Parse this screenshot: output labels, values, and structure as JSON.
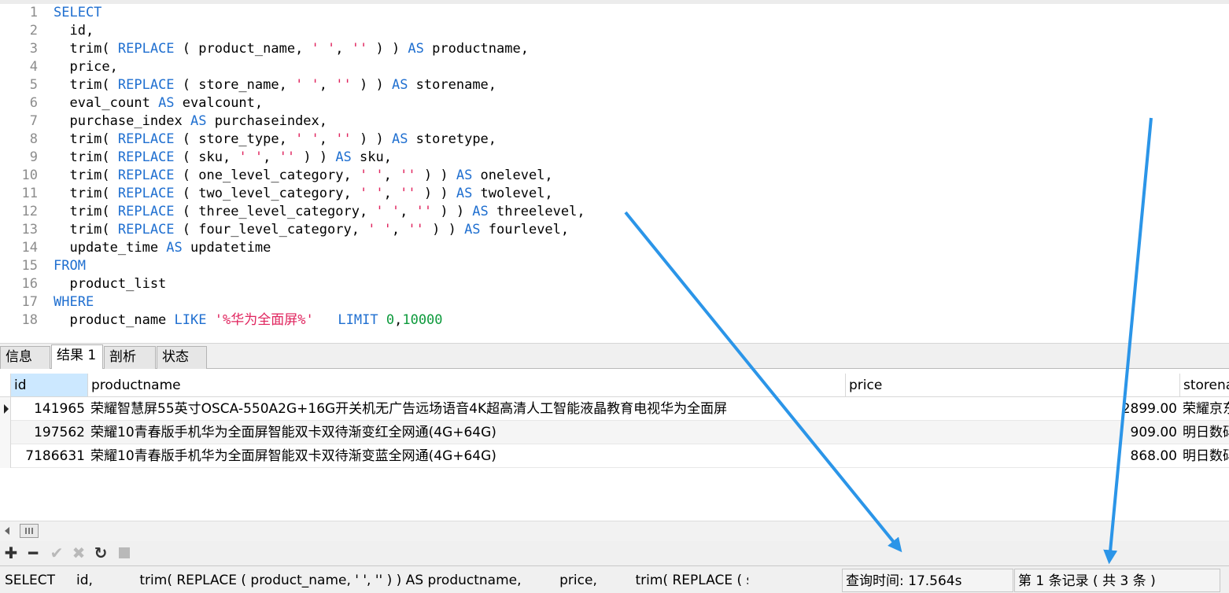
{
  "editor": {
    "lines": [
      {
        "n": "1",
        "tokens": [
          {
            "t": "SELECT",
            "c": "kw"
          }
        ]
      },
      {
        "n": "2",
        "tokens": [
          {
            "t": "  id,",
            "c": "plain"
          }
        ]
      },
      {
        "n": "3",
        "tokens": [
          {
            "t": "  trim( ",
            "c": "plain"
          },
          {
            "t": "REPLACE",
            "c": "kw"
          },
          {
            "t": " ( product_name, ",
            "c": "plain"
          },
          {
            "t": "' '",
            "c": "str"
          },
          {
            "t": ", ",
            "c": "plain"
          },
          {
            "t": "''",
            "c": "str"
          },
          {
            "t": " ) ) ",
            "c": "plain"
          },
          {
            "t": "AS",
            "c": "kw"
          },
          {
            "t": " productname,",
            "c": "plain"
          }
        ]
      },
      {
        "n": "4",
        "tokens": [
          {
            "t": "  price,",
            "c": "plain"
          }
        ]
      },
      {
        "n": "5",
        "tokens": [
          {
            "t": "  trim( ",
            "c": "plain"
          },
          {
            "t": "REPLACE",
            "c": "kw"
          },
          {
            "t": " ( store_name, ",
            "c": "plain"
          },
          {
            "t": "' '",
            "c": "str"
          },
          {
            "t": ", ",
            "c": "plain"
          },
          {
            "t": "''",
            "c": "str"
          },
          {
            "t": " ) ) ",
            "c": "plain"
          },
          {
            "t": "AS",
            "c": "kw"
          },
          {
            "t": " storename,",
            "c": "plain"
          }
        ]
      },
      {
        "n": "6",
        "tokens": [
          {
            "t": "  eval_count ",
            "c": "plain"
          },
          {
            "t": "AS",
            "c": "kw"
          },
          {
            "t": " evalcount,",
            "c": "plain"
          }
        ]
      },
      {
        "n": "7",
        "tokens": [
          {
            "t": "  purchase_index ",
            "c": "plain"
          },
          {
            "t": "AS",
            "c": "kw"
          },
          {
            "t": " purchaseindex,",
            "c": "plain"
          }
        ]
      },
      {
        "n": "8",
        "tokens": [
          {
            "t": "  trim( ",
            "c": "plain"
          },
          {
            "t": "REPLACE",
            "c": "kw"
          },
          {
            "t": " ( store_type, ",
            "c": "plain"
          },
          {
            "t": "' '",
            "c": "str"
          },
          {
            "t": ", ",
            "c": "plain"
          },
          {
            "t": "''",
            "c": "str"
          },
          {
            "t": " ) ) ",
            "c": "plain"
          },
          {
            "t": "AS",
            "c": "kw"
          },
          {
            "t": " storetype,",
            "c": "plain"
          }
        ]
      },
      {
        "n": "9",
        "tokens": [
          {
            "t": "  trim( ",
            "c": "plain"
          },
          {
            "t": "REPLACE",
            "c": "kw"
          },
          {
            "t": " ( sku, ",
            "c": "plain"
          },
          {
            "t": "' '",
            "c": "str"
          },
          {
            "t": ", ",
            "c": "plain"
          },
          {
            "t": "''",
            "c": "str"
          },
          {
            "t": " ) ) ",
            "c": "plain"
          },
          {
            "t": "AS",
            "c": "kw"
          },
          {
            "t": " sku,",
            "c": "plain"
          }
        ]
      },
      {
        "n": "10",
        "tokens": [
          {
            "t": "  trim( ",
            "c": "plain"
          },
          {
            "t": "REPLACE",
            "c": "kw"
          },
          {
            "t": " ( one_level_category, ",
            "c": "plain"
          },
          {
            "t": "' '",
            "c": "str"
          },
          {
            "t": ", ",
            "c": "plain"
          },
          {
            "t": "''",
            "c": "str"
          },
          {
            "t": " ) ) ",
            "c": "plain"
          },
          {
            "t": "AS",
            "c": "kw"
          },
          {
            "t": " onelevel,",
            "c": "plain"
          }
        ]
      },
      {
        "n": "11",
        "tokens": [
          {
            "t": "  trim( ",
            "c": "plain"
          },
          {
            "t": "REPLACE",
            "c": "kw"
          },
          {
            "t": " ( two_level_category, ",
            "c": "plain"
          },
          {
            "t": "' '",
            "c": "str"
          },
          {
            "t": ", ",
            "c": "plain"
          },
          {
            "t": "''",
            "c": "str"
          },
          {
            "t": " ) ) ",
            "c": "plain"
          },
          {
            "t": "AS",
            "c": "kw"
          },
          {
            "t": " twolevel,",
            "c": "plain"
          }
        ]
      },
      {
        "n": "12",
        "tokens": [
          {
            "t": "  trim( ",
            "c": "plain"
          },
          {
            "t": "REPLACE",
            "c": "kw"
          },
          {
            "t": " ( three_level_category, ",
            "c": "plain"
          },
          {
            "t": "' '",
            "c": "str"
          },
          {
            "t": ", ",
            "c": "plain"
          },
          {
            "t": "''",
            "c": "str"
          },
          {
            "t": " ) ) ",
            "c": "plain"
          },
          {
            "t": "AS",
            "c": "kw"
          },
          {
            "t": " threelevel,",
            "c": "plain"
          }
        ]
      },
      {
        "n": "13",
        "tokens": [
          {
            "t": "  trim( ",
            "c": "plain"
          },
          {
            "t": "REPLACE",
            "c": "kw"
          },
          {
            "t": " ( four_level_category, ",
            "c": "plain"
          },
          {
            "t": "' '",
            "c": "str"
          },
          {
            "t": ", ",
            "c": "plain"
          },
          {
            "t": "''",
            "c": "str"
          },
          {
            "t": " ) ) ",
            "c": "plain"
          },
          {
            "t": "AS",
            "c": "kw"
          },
          {
            "t": " fourlevel,",
            "c": "plain"
          }
        ]
      },
      {
        "n": "14",
        "tokens": [
          {
            "t": "  update_time ",
            "c": "plain"
          },
          {
            "t": "AS",
            "c": "kw"
          },
          {
            "t": " updatetime",
            "c": "plain"
          }
        ]
      },
      {
        "n": "15",
        "tokens": [
          {
            "t": "FROM",
            "c": "kw"
          }
        ]
      },
      {
        "n": "16",
        "tokens": [
          {
            "t": "  product_list",
            "c": "plain"
          }
        ]
      },
      {
        "n": "17",
        "tokens": [
          {
            "t": "WHERE",
            "c": "kw"
          }
        ]
      },
      {
        "n": "18",
        "tokens": [
          {
            "t": "  product_name ",
            "c": "plain"
          },
          {
            "t": "LIKE",
            "c": "kw"
          },
          {
            "t": " ",
            "c": "plain"
          },
          {
            "t": "'%华为全面屏%'",
            "c": "str"
          },
          {
            "t": "   ",
            "c": "plain"
          },
          {
            "t": "LIMIT",
            "c": "kw"
          },
          {
            "t": " ",
            "c": "plain"
          },
          {
            "t": "0",
            "c": "num"
          },
          {
            "t": ",",
            "c": "plain"
          },
          {
            "t": "10000",
            "c": "num"
          }
        ]
      }
    ]
  },
  "tabs": [
    {
      "label": "信息",
      "active": false
    },
    {
      "label": "结果 1",
      "active": true
    },
    {
      "label": "剖析",
      "active": false
    },
    {
      "label": "状态",
      "active": false
    }
  ],
  "grid": {
    "columns": [
      "id",
      "productname",
      "price",
      "storena"
    ],
    "rows": [
      {
        "id": "141965",
        "productname": "荣耀智慧屏55英寸OSCA-550A2G+16G开关机无广告远场语音4K超高清人工智能液晶教育电视华为全面屏",
        "price": "2899.00",
        "storename": "荣耀京东"
      },
      {
        "id": "197562",
        "productname": "荣耀10青春版手机华为全面屏智能双卡双待渐变红全网通(4G+64G)",
        "price": "909.00",
        "storename": "明日数码"
      },
      {
        "id": "7186631",
        "productname": "荣耀10青春版手机华为全面屏智能双卡双待渐变蓝全网通(4G+64G)",
        "price": "868.00",
        "storename": "明日数码"
      }
    ]
  },
  "toolbar": {
    "icons": [
      "add-icon",
      "remove-icon",
      "check-icon",
      "cancel-icon",
      "refresh-icon",
      "stop-icon"
    ]
  },
  "status": {
    "sql_preview": "SELECT     id,           trim( REPLACE ( product_name, ' ', '' ) ) AS productname,         price,         trim( REPLACE ( st",
    "query_time": "查询时间: 17.564s",
    "record_info": "第 1 条记录 ( 共 3 条 )"
  },
  "colors": {
    "keyword": "#1f6fd0",
    "string": "#e0245e",
    "number": "#0d9a3c",
    "selected_header": "#cce8ff",
    "annotation_arrow": "#2b95e8"
  }
}
